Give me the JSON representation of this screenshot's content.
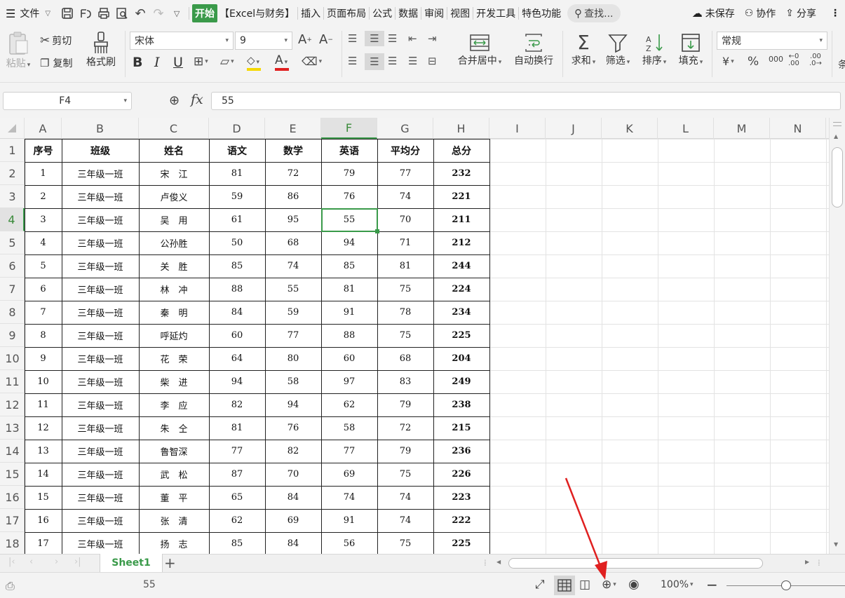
{
  "menubar": {
    "file_label": "文件",
    "tabs": [
      "开始",
      "【Excel与财务】",
      "插入",
      "页面布局",
      "公式",
      "数据",
      "审阅",
      "视图",
      "开发工具",
      "特色功能"
    ],
    "search_label": "查找...",
    "unsaved_label": "未保存",
    "collab_label": "协作",
    "share_label": "分享"
  },
  "ribbon": {
    "paste_label": "粘贴",
    "cut_label": "剪切",
    "copy_label": "复制",
    "format_painter_label": "格式刷",
    "font_name": "宋体",
    "font_size": "9",
    "merge_label": "合并居中",
    "wrap_label": "自动换行",
    "sum_label": "求和",
    "filter_label": "筛选",
    "sort_label": "排序",
    "fill_label": "填充",
    "number_format": "常规",
    "currency_symbol": "¥",
    "percent_symbol": "%",
    "thousands_symbol": "000",
    "inc_decimal": ".00",
    "dec_decimal": ".0",
    "cond_label": "条"
  },
  "formula_bar": {
    "name_box": "F4",
    "fx_label": "fx",
    "value": "55"
  },
  "columns": [
    "A",
    "B",
    "C",
    "D",
    "E",
    "F",
    "G",
    "H",
    "I",
    "J",
    "K",
    "L",
    "M",
    "N"
  ],
  "rows": [
    "1",
    "2",
    "3",
    "4",
    "5",
    "6",
    "7",
    "8",
    "9",
    "10",
    "11",
    "12",
    "13",
    "14",
    "15",
    "16",
    "17",
    "18"
  ],
  "table": {
    "headers": [
      "序号",
      "班级",
      "姓名",
      "语文",
      "数学",
      "英语",
      "平均分",
      "总分"
    ],
    "data": [
      [
        "1",
        "三年级一班",
        "宋　江",
        "81",
        "72",
        "79",
        "77",
        "232"
      ],
      [
        "2",
        "三年级一班",
        "卢俊义",
        "59",
        "86",
        "76",
        "74",
        "221"
      ],
      [
        "3",
        "三年级一班",
        "吴　用",
        "61",
        "95",
        "55",
        "70",
        "211"
      ],
      [
        "4",
        "三年级一班",
        "公孙胜",
        "50",
        "68",
        "94",
        "71",
        "212"
      ],
      [
        "5",
        "三年级一班",
        "关　胜",
        "85",
        "74",
        "85",
        "81",
        "244"
      ],
      [
        "6",
        "三年级一班",
        "林　冲",
        "88",
        "55",
        "81",
        "75",
        "224"
      ],
      [
        "7",
        "三年级一班",
        "秦　明",
        "84",
        "59",
        "91",
        "78",
        "234"
      ],
      [
        "8",
        "三年级一班",
        "呼延灼",
        "60",
        "77",
        "88",
        "75",
        "225"
      ],
      [
        "9",
        "三年级一班",
        "花　荣",
        "64",
        "80",
        "60",
        "68",
        "204"
      ],
      [
        "10",
        "三年级一班",
        "柴　进",
        "94",
        "58",
        "97",
        "83",
        "249"
      ],
      [
        "11",
        "三年级一班",
        "李　应",
        "82",
        "94",
        "62",
        "79",
        "238"
      ],
      [
        "12",
        "三年级一班",
        "朱　仝",
        "81",
        "76",
        "58",
        "72",
        "215"
      ],
      [
        "13",
        "三年级一班",
        "鲁智深",
        "77",
        "82",
        "77",
        "79",
        "236"
      ],
      [
        "14",
        "三年级一班",
        "武　松",
        "87",
        "70",
        "69",
        "75",
        "226"
      ],
      [
        "15",
        "三年级一班",
        "董　平",
        "65",
        "84",
        "74",
        "74",
        "223"
      ],
      [
        "16",
        "三年级一班",
        "张　清",
        "62",
        "69",
        "91",
        "74",
        "222"
      ],
      [
        "17",
        "三年级一班",
        "扬　志",
        "85",
        "84",
        "56",
        "75",
        "225"
      ]
    ]
  },
  "selection": {
    "column": "F",
    "row": "4"
  },
  "sheet_tabs": {
    "active": "Sheet1",
    "add_label": "+"
  },
  "status_bar": {
    "cell_value": "55",
    "zoom": "100%",
    "zoom_level": 0.5
  },
  "colors": {
    "accent": "#3a9a4a",
    "arrow": "#e02020"
  }
}
